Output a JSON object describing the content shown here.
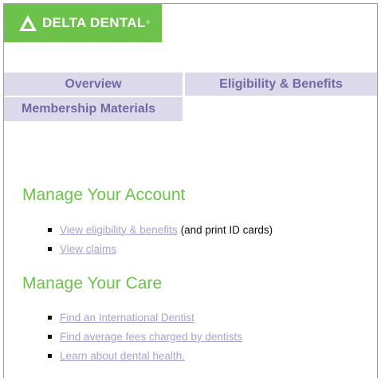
{
  "brand": {
    "name": "DELTA DENTAL",
    "logo_icon": "delta-triangle-icon",
    "color": "#6cc24a"
  },
  "tabs": [
    {
      "label": "Overview"
    },
    {
      "label": "Eligibility & Benefits"
    },
    {
      "label": "Membership Materials"
    }
  ],
  "account": {
    "heading": "Manage Your Account",
    "links": [
      {
        "label": "View eligibility & benefits",
        "suffix": "(and print ID cards)"
      },
      {
        "label": "View claims"
      }
    ]
  },
  "care": {
    "heading": "Manage Your Care",
    "links": [
      {
        "label": "Find an International Dentist"
      },
      {
        "label": "Find average fees charged by dentists"
      },
      {
        "label": "Learn about dental health."
      }
    ]
  },
  "colors": {
    "tab_bg": "#dcdaea",
    "tab_text": "#6f6aa6",
    "link": "#a7a3cf",
    "heading": "#6cc24a"
  }
}
